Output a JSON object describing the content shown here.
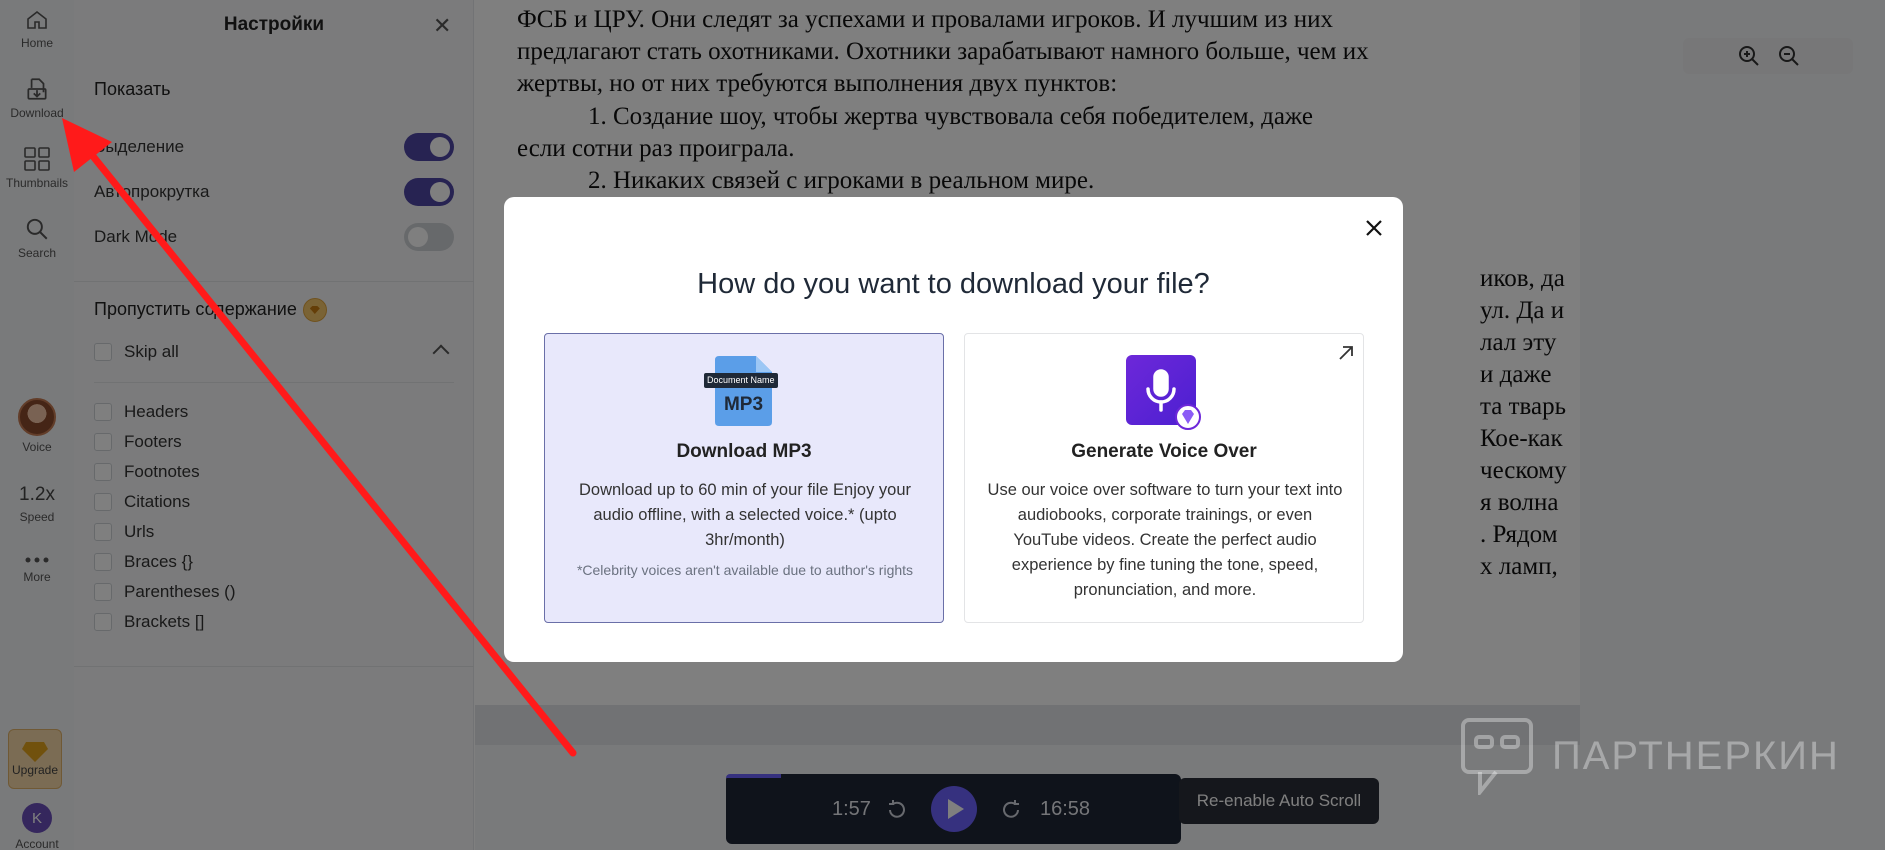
{
  "rail": {
    "home": "Home",
    "download": "Download",
    "thumbnails": "Thumbnails",
    "search": "Search",
    "voice": "Voice",
    "speed_value": "1.2x",
    "speed": "Speed",
    "more": "More",
    "upgrade": "Upgrade",
    "account_initial": "K",
    "account": "Account"
  },
  "settings": {
    "title": "Настройки",
    "show_section": "Показать",
    "toggles": [
      {
        "label": "Выделение",
        "on": true
      },
      {
        "label": "Автопрокрутка",
        "on": true
      },
      {
        "label": "Dark Mode",
        "on": false
      }
    ],
    "skip_section": "Пропустить содержание",
    "skip_all": "Skip all",
    "items": [
      "Headers",
      "Footers",
      "Footnotes",
      "Citations",
      "Urls",
      "Braces {}",
      "Parentheses ()",
      "Brackets []"
    ]
  },
  "document": {
    "lines": [
      "ФСБ и ЦРУ. Они следят за успехами и провалами игроков. И лучшим из них",
      "предлагают стать охотниками. Охотники зарабатывают намного больше, чем их",
      "жертвы, но от них требуются выполнения двух пунктов:",
      "1.      Создание шоу, чтобы жертва чувствовала себя победителем, даже",
      "если сотни раз проиграла.",
      "2.      Никаких связей с игроками в реальном мире."
    ],
    "right_fragments": [
      "иков, да",
      "ул. Да и",
      "лал эту",
      "и даже",
      "та тварь",
      "Кое-как",
      "ческому",
      "я волна",
      ". Рядом",
      "х ламп,"
    ]
  },
  "player": {
    "elapsed": "1:57",
    "total": "16:58",
    "progress": 0.12,
    "reenable": "Re-enable Auto Scroll"
  },
  "modal": {
    "title": "How do you want to download your file?",
    "mp3": {
      "doc_label": "Document Name",
      "icon_text": "MP3",
      "title": "Download MP3",
      "desc": "Download up to 60 min of your file Enjoy your audio offline, with a selected voice.* (upto 3hr/month)",
      "note": "*Celebrity voices aren't available due to author's rights"
    },
    "voiceover": {
      "title": "Generate Voice Over",
      "desc": "Use our voice over software to turn your text into audiobooks, corporate trainings, or even YouTube videos. Create the perfect audio experience by fine tuning the tone, speed, pronunciation, and more."
    }
  },
  "watermark": "ПАРТНЕРКИН",
  "colors": {
    "accent": "#4f46a5",
    "play": "#6c63ff",
    "arrow": "#ff1a1a",
    "selected_card": "#e8e8fb"
  }
}
